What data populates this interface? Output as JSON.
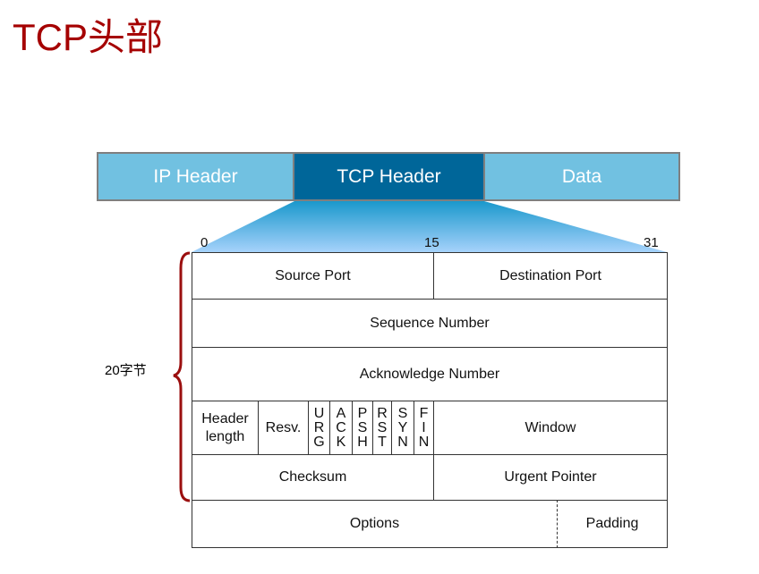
{
  "title": "TCP头部",
  "packet": {
    "ip": "IP Header",
    "tcp": "TCP  Header",
    "data": "Data"
  },
  "bits": {
    "start": "0",
    "mid": "15",
    "end": "31"
  },
  "size_label": "20字节",
  "fields": {
    "source_port": "Source Port",
    "destination_port": "Destination Port",
    "sequence": "Sequence Number",
    "ack": "Acknowledge Number",
    "header_length": "Header length",
    "reserved": "Resv.",
    "flags": [
      {
        "l1": "U",
        "l2": "R",
        "l3": "G"
      },
      {
        "l1": "A",
        "l2": "C",
        "l3": "K"
      },
      {
        "l1": "P",
        "l2": "S",
        "l3": "H"
      },
      {
        "l1": "R",
        "l2": "S",
        "l3": "T"
      },
      {
        "l1": "S",
        "l2": "Y",
        "l3": "N"
      },
      {
        "l1": "F",
        "l2": "I",
        "l3": "N"
      }
    ],
    "window": "Window",
    "checksum": "Checksum",
    "urgent": "Urgent Pointer",
    "options": "Options",
    "padding": "Padding"
  },
  "colors": {
    "light": "#70c0e0",
    "dark": "#006699",
    "title": "#a50000"
  }
}
